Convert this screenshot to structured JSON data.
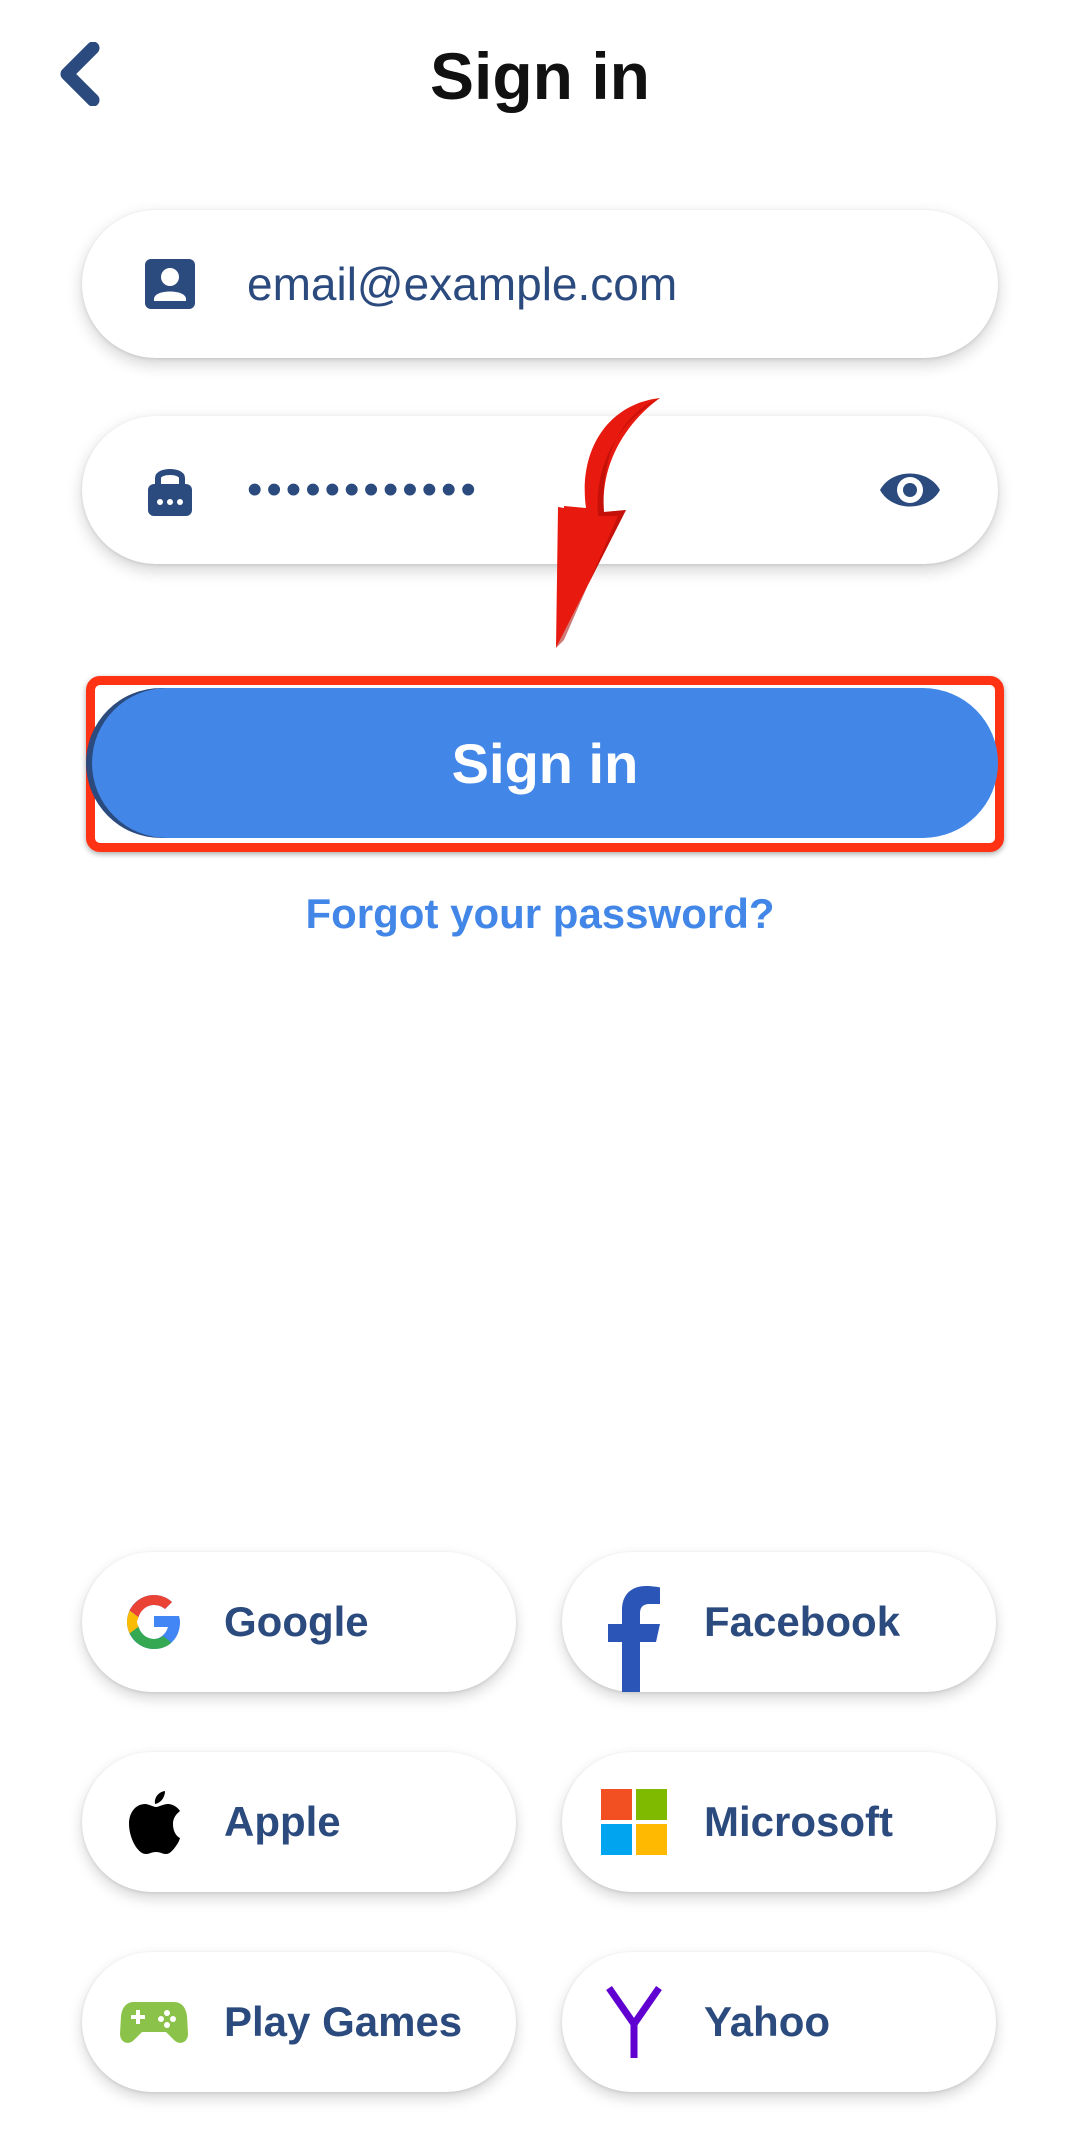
{
  "header": {
    "title": "Sign in"
  },
  "form": {
    "email_placeholder": "email@example.com",
    "password_value": "••••••••••••",
    "submit_label": "Sign in",
    "forgot_label": "Forgot your password?"
  },
  "social": [
    {
      "label": "Google",
      "icon": "google-icon"
    },
    {
      "label": "Facebook",
      "icon": "facebook-icon"
    },
    {
      "label": "Apple",
      "icon": "apple-icon"
    },
    {
      "label": "Microsoft",
      "icon": "microsoft-icon"
    },
    {
      "label": "Play Games",
      "icon": "play-games-icon"
    },
    {
      "label": "Yahoo",
      "icon": "yahoo-icon"
    }
  ],
  "colors": {
    "primary": "#4287e8",
    "navy": "#2b4a7e",
    "highlight": "#ff3214",
    "arrow": "#e8190e"
  }
}
